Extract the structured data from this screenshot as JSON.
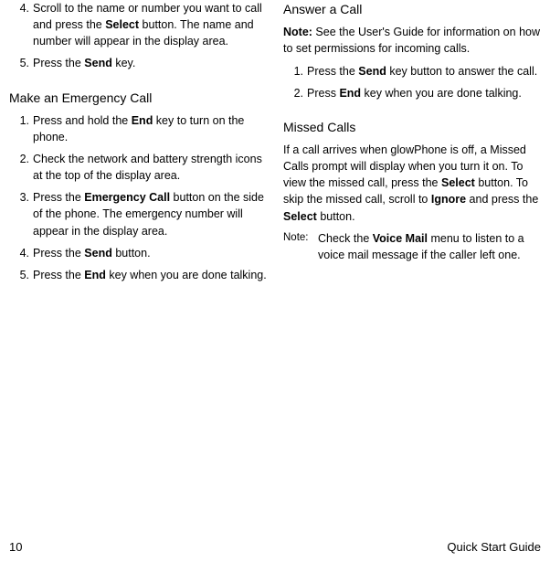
{
  "left": {
    "topList": [
      {
        "n": "4.",
        "html": "Scroll to the name or number you want to call and press the <b>Select</b> button. The name and number will appear in the display area."
      },
      {
        "n": "5.",
        "html": "Press the <b>Send</b> key."
      }
    ],
    "heading1": "Make an Emergency Call",
    "list1": [
      {
        "n": "1.",
        "html": "Press and hold the <b>End</b> key to turn on the phone."
      },
      {
        "n": "2.",
        "html": "Check the network and battery strength icons at the top of the display area."
      },
      {
        "n": "3.",
        "html": "Press the <b>Emergency Call</b> button on the side of the phone. The  emergency number will appear in the display area."
      },
      {
        "n": "4.",
        "html": "Press the <b>Send</b> button."
      },
      {
        "n": "5.",
        "html": "Press the <b>End</b> key when you are done talking."
      }
    ]
  },
  "right": {
    "heading1": "Answer a Call",
    "note1": "<b>Note:</b> See the User's Guide for information on how to set permissions for incoming calls.",
    "list1": [
      {
        "n": "1.",
        "html": "Press the <b>Send</b> key button to answer the call."
      },
      {
        "n": "2.",
        "html": "Press <b>End</b> key when you are done talking."
      }
    ],
    "heading2": "Missed Calls",
    "para2": "If a call arrives when glowPhone is off, a Missed Calls prompt will display when you turn it on. To view the missed call, press the <b>Select</b> button. To skip the missed call, scroll to <b>Ignore</b> and press the <b>Select</b> button.",
    "note2Label": "Note:",
    "note2Body": "Check the <b>Voice Mail</b> menu to listen to a voice mail message if the caller left one."
  },
  "footer": {
    "page": "10",
    "title": "Quick Start Guide"
  }
}
